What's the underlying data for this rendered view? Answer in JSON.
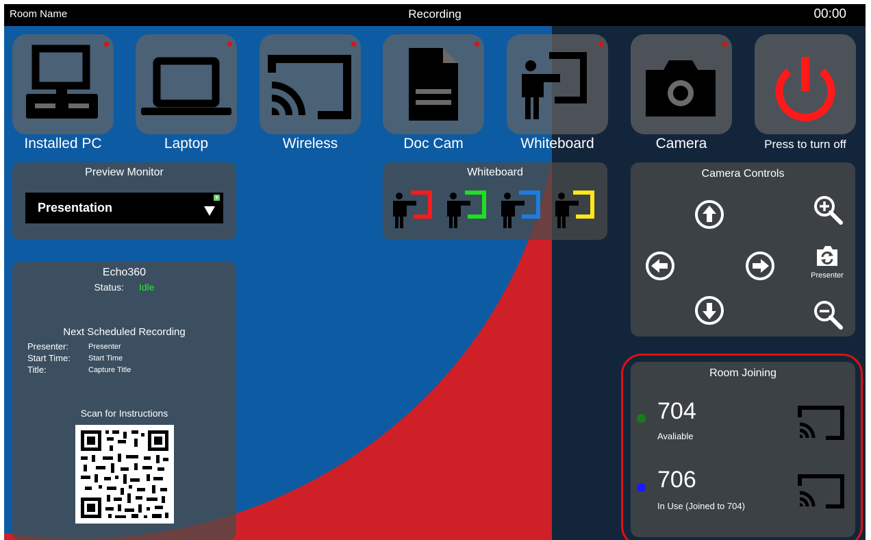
{
  "topbar": {
    "room_name": "Room Name",
    "title": "Recording",
    "timer": "00:00"
  },
  "sources": [
    {
      "label": "Installed PC",
      "icon": "desktop-pc-icon"
    },
    {
      "label": "Laptop",
      "icon": "laptop-icon"
    },
    {
      "label": "Wireless",
      "icon": "cast-icon"
    },
    {
      "label": "Doc Cam",
      "icon": "document-icon"
    },
    {
      "label": "Whiteboard",
      "icon": "presenter-board-icon"
    },
    {
      "label": "Camera",
      "icon": "camera-icon"
    },
    {
      "label": "Press to turn off",
      "icon": "power-icon"
    }
  ],
  "preview_monitor": {
    "title": "Preview Monitor",
    "selected": "Presentation"
  },
  "whiteboard_panel": {
    "title": "Whiteboard",
    "colors": [
      "#ff1a1a",
      "#1ee01e",
      "#1a7ee0",
      "#ffe81a"
    ]
  },
  "camera_controls": {
    "title": "Camera Controls",
    "switch_label": "Presenter"
  },
  "echo": {
    "title": "Echo360",
    "status_label": "Status:",
    "status_value": "Idle",
    "next_title": "Next Scheduled Recording",
    "rows": [
      {
        "label": "Presenter:",
        "value": "Presenter"
      },
      {
        "label": "Start Time:",
        "value": "Start Time"
      },
      {
        "label": "Title:",
        "value": "Capture Title"
      }
    ],
    "scan_label": "Scan for Instructions"
  },
  "room_joining": {
    "title": "Room Joining",
    "rooms": [
      {
        "number": "704",
        "status": "Avaliable",
        "color": "#1a7a1a"
      },
      {
        "number": "706",
        "status": "In Use (Joined to 704)",
        "color": "#1a1aff"
      }
    ]
  },
  "colors": {
    "power": "#ff1a1a",
    "status_idle": "#2ee02e",
    "highlight": "#e01010"
  }
}
